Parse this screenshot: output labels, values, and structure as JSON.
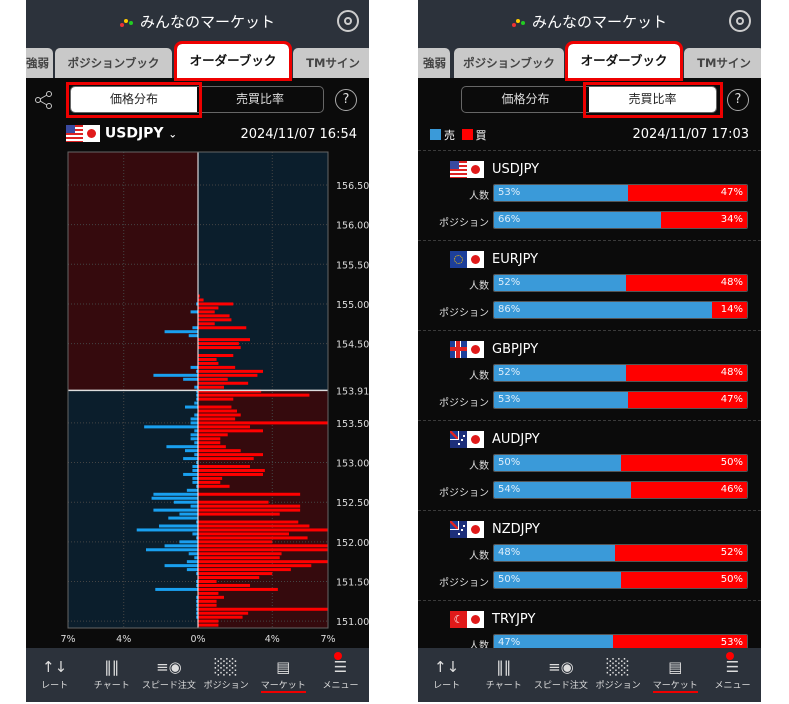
{
  "app_title": "みんなのマーケット",
  "tabs": [
    "強弱",
    "ポジションブック",
    "オーダーブック",
    "TMサイン"
  ],
  "segments": [
    "価格分布",
    "売買比率"
  ],
  "help": "?",
  "nav": [
    {
      "label": "レート",
      "icon": "rate-arrows-icon"
    },
    {
      "label": "チャート",
      "icon": "candlestick-icon"
    },
    {
      "label": "スピード注文",
      "icon": "speed-order-icon"
    },
    {
      "label": "ポジション",
      "icon": "position-bars-icon"
    },
    {
      "label": "マーケット",
      "icon": "newspaper-icon"
    },
    {
      "label": "メニュー",
      "icon": "menu-list-icon"
    }
  ],
  "colors": {
    "sell": "#3a9ad9",
    "buy": "#ff0000",
    "highlight": "#e00000"
  },
  "left": {
    "pair": "USDJPY",
    "timestamp": "2024/11/07 16:54",
    "chart_data": {
      "type": "bar",
      "orientation": "horizontal",
      "current_price": 153.91,
      "ylim": [
        150.91,
        156.92
      ],
      "y_ticks": [
        "156.50",
        "156.00",
        "155.50",
        "155.00",
        "154.50",
        "153.91",
        "153.50",
        "153.00",
        "152.50",
        "152.00",
        "151.50",
        "151.00"
      ],
      "x_ticks": [
        "7%",
        "4%",
        "0%",
        "4%",
        "7%"
      ],
      "xlim_percent": 7,
      "rows": [
        [
          155.1,
          0,
          0.1
        ],
        [
          155.05,
          0,
          0.3
        ],
        [
          155.0,
          0.1,
          1.9
        ],
        [
          154.95,
          0,
          1.1
        ],
        [
          154.9,
          0.4,
          0.9
        ],
        [
          154.85,
          0,
          1.7
        ],
        [
          154.8,
          0,
          1.8
        ],
        [
          154.75,
          0,
          0.9
        ],
        [
          154.7,
          0.3,
          2.6
        ],
        [
          154.65,
          1.8,
          0
        ],
        [
          154.6,
          0.5,
          0
        ],
        [
          154.55,
          0,
          2.8
        ],
        [
          154.5,
          0,
          2.2
        ],
        [
          154.45,
          0,
          2.3
        ],
        [
          154.35,
          0,
          1.9
        ],
        [
          154.3,
          0,
          1.0
        ],
        [
          154.25,
          0,
          1.1
        ],
        [
          154.2,
          0.4,
          2.0
        ],
        [
          154.15,
          0.1,
          3.5
        ],
        [
          154.1,
          2.4,
          3.2
        ],
        [
          154.05,
          0.8,
          1.6
        ],
        [
          154.0,
          0,
          2.7
        ],
        [
          153.95,
          0.2,
          1.4
        ],
        [
          153.9,
          0.1,
          3.4
        ],
        [
          153.85,
          0.1,
          6.0
        ],
        [
          153.8,
          0.1,
          1.9
        ],
        [
          153.75,
          0.2,
          0
        ],
        [
          153.7,
          0.7,
          1.8
        ],
        [
          153.65,
          0,
          2.1
        ],
        [
          153.6,
          0.2,
          2.3
        ],
        [
          153.55,
          0.4,
          2.0
        ],
        [
          153.5,
          0.4,
          7.0
        ],
        [
          153.45,
          2.9,
          2.8
        ],
        [
          153.4,
          0.2,
          3.5
        ],
        [
          153.35,
          0.4,
          1.6
        ],
        [
          153.3,
          0.4,
          1.2
        ],
        [
          153.25,
          0.2,
          1.2
        ],
        [
          153.2,
          1.7,
          1.5
        ],
        [
          153.15,
          0.7,
          2.3
        ],
        [
          153.1,
          0.2,
          3.5
        ],
        [
          153.05,
          0.8,
          3.0
        ],
        [
          153.0,
          0.1,
          0
        ],
        [
          152.95,
          0.3,
          2.8
        ],
        [
          152.9,
          0.3,
          3.6
        ],
        [
          152.85,
          0.8,
          3.5
        ],
        [
          152.8,
          0.3,
          1.3
        ],
        [
          152.75,
          0.3,
          1.2
        ],
        [
          152.7,
          0.1,
          1.7
        ],
        [
          152.65,
          0.6,
          0
        ],
        [
          152.6,
          2.4,
          5.5
        ],
        [
          152.55,
          2.5,
          0
        ],
        [
          152.5,
          1.3,
          3.8
        ],
        [
          152.45,
          0.4,
          5.5
        ],
        [
          152.4,
          2.4,
          5.5
        ],
        [
          152.35,
          1.0,
          4.4
        ],
        [
          152.3,
          1.6,
          0
        ],
        [
          152.25,
          0.1,
          5.4
        ],
        [
          152.2,
          2.1,
          6.0
        ],
        [
          152.15,
          3.3,
          7.0
        ],
        [
          152.1,
          0.3,
          4.9
        ],
        [
          152.05,
          0.1,
          5.9
        ],
        [
          152.0,
          1.0,
          4.0
        ],
        [
          151.95,
          1.8,
          7.0
        ],
        [
          151.9,
          2.8,
          7.0
        ],
        [
          151.85,
          0.5,
          4.5
        ],
        [
          151.8,
          0.2,
          4.4
        ],
        [
          151.75,
          0.6,
          7.0
        ],
        [
          151.7,
          1.8,
          6.1
        ],
        [
          151.65,
          0.6,
          5.0
        ],
        [
          151.6,
          0.1,
          4.0
        ],
        [
          151.55,
          0,
          3.3
        ],
        [
          151.5,
          0.1,
          1.0
        ],
        [
          151.45,
          0.1,
          2.8
        ],
        [
          151.4,
          2.3,
          4.3
        ],
        [
          151.35,
          0,
          1.1
        ],
        [
          151.3,
          0.1,
          1.4
        ],
        [
          151.25,
          0.1,
          1.0
        ],
        [
          151.2,
          0.1,
          1.0
        ],
        [
          151.15,
          0.1,
          7.0
        ],
        [
          151.1,
          0.1,
          2.7
        ],
        [
          151.05,
          0.1,
          2.4
        ],
        [
          151.0,
          0,
          1.1
        ],
        [
          150.95,
          0,
          1.1
        ]
      ],
      "row_format": [
        "price",
        "sell_percent",
        "buy_percent"
      ]
    }
  },
  "right": {
    "legend": {
      "sell": "売",
      "buy": "買"
    },
    "timestamp": "2024/11/07 17:03",
    "row_labels": {
      "people": "人数",
      "position": "ポジション"
    },
    "pairs": [
      {
        "name": "USDJPY",
        "flag": "us",
        "people": [
          53,
          47
        ],
        "position": [
          66,
          34
        ]
      },
      {
        "name": "EURJPY",
        "flag": "eu",
        "people": [
          52,
          48
        ],
        "position": [
          86,
          14
        ]
      },
      {
        "name": "GBPJPY",
        "flag": "gb",
        "people": [
          52,
          48
        ],
        "position": [
          53,
          47
        ]
      },
      {
        "name": "AUDJPY",
        "flag": "au",
        "people": [
          50,
          50
        ],
        "position": [
          54,
          46
        ]
      },
      {
        "name": "NZDJPY",
        "flag": "nz",
        "people": [
          48,
          52
        ],
        "position": [
          50,
          50
        ]
      },
      {
        "name": "TRYJPY",
        "flag": "tr",
        "people": [
          47,
          53
        ]
      }
    ]
  }
}
